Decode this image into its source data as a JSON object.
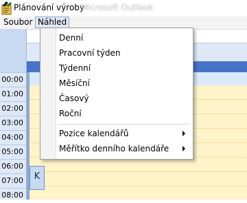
{
  "window": {
    "title": "Plánování výroby",
    "background_title": "Microsoft Outlook"
  },
  "menubar": {
    "items": [
      {
        "label": "Soubor"
      },
      {
        "label": "Náhled"
      }
    ]
  },
  "view_menu": {
    "items": [
      {
        "label": "Denní"
      },
      {
        "label": "Pracovní týden"
      },
      {
        "label": "Týdenní"
      },
      {
        "label": "Měsíční"
      },
      {
        "label": "Časový"
      },
      {
        "label": "Roční"
      }
    ],
    "submenus": [
      {
        "label": "Pozice kalendářů"
      },
      {
        "label": "Měřítko denního kalendáře"
      }
    ]
  },
  "calendar": {
    "times": [
      "00:00",
      "01:00",
      "02:00",
      "03:00",
      "04:00",
      "05:00",
      "06:00",
      "07:00",
      "08:00"
    ],
    "nav_button_glyph": "K",
    "colors": {
      "header_bar": "#4874c7",
      "work_area": "#fff3c9",
      "time_column": "#dfe8f6"
    }
  },
  "icons": {
    "app": "planner-app-icon",
    "collapse": "collapse-left-icon",
    "submenu_arrow": "chevron-right-icon"
  }
}
